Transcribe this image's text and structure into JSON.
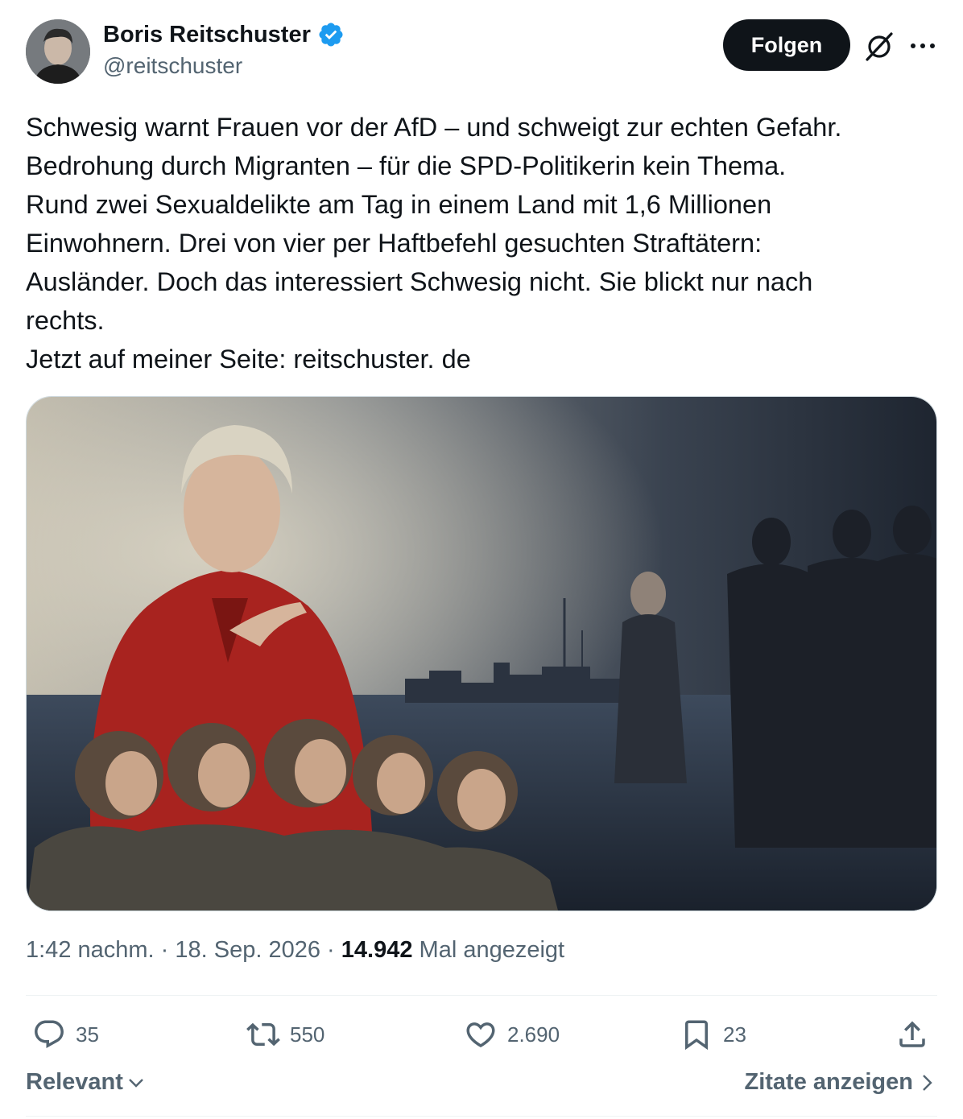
{
  "author": {
    "name": "Boris Reitschuster",
    "handle": "@reitschuster",
    "verified_color": "#1d9bf0"
  },
  "header": {
    "follow_label": "Folgen",
    "grok_icon": "grok-icon",
    "more_icon": "more-icon"
  },
  "post": {
    "lines": [
      "Schwesig warnt Frauen vor der AfD – und schweigt zur echten Gefahr.",
      "Bedrohung durch Migranten – für die SPD-Politikerin kein Thema.",
      "Rund zwei Sexualdelikte am Tag in einem Land mit 1,6 Millionen",
      "Einwohnern. Drei von vier per Haftbefehl gesuchten Straftätern:",
      "Ausländer. Doch das interessiert Schwesig nicht. Sie blickt nur nach",
      "rechts.",
      "Jetzt auf meiner Seite: reitschuster. de"
    ]
  },
  "meta": {
    "time": "1:42 nachm.",
    "sep1": " · ",
    "date": "18. Sep. 2026",
    "sep2": " · ",
    "views": "14.942",
    "views_label": " Mal angezeigt"
  },
  "actions": {
    "replies": "35",
    "reposts": "550",
    "likes": "2.690",
    "bookmarks": "23"
  },
  "footer": {
    "sort_label": "Relevant",
    "quotes_label": "Zitate anzeigen"
  },
  "colors": {
    "text": "#0f1419",
    "secondary": "#536471",
    "border": "#eff3f4",
    "blazer": "#b3231f"
  }
}
